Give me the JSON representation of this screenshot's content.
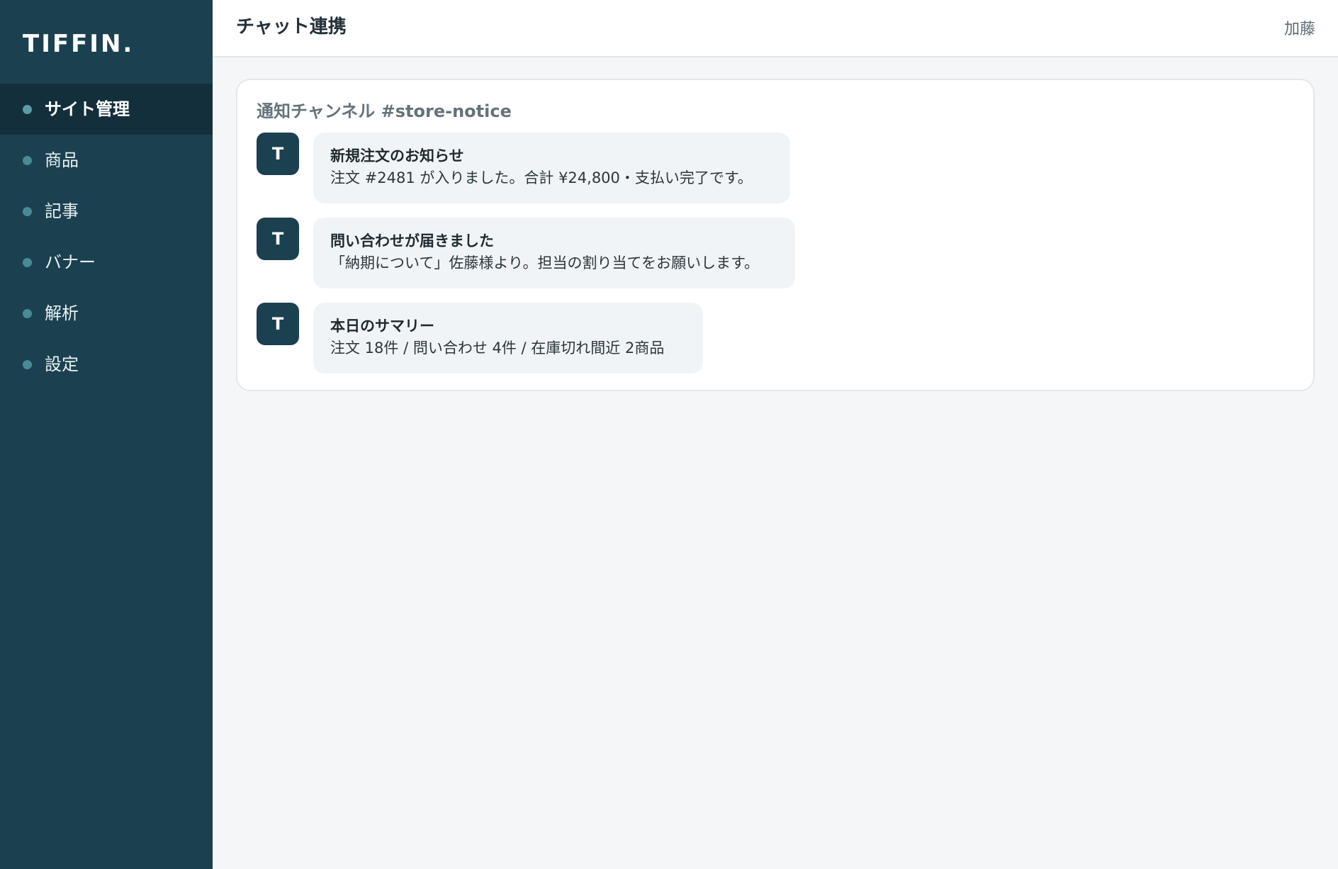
{
  "sidebar": {
    "logo": "TIFFIN.",
    "items": [
      {
        "label": "サイト管理",
        "active": true
      },
      {
        "label": "商品",
        "active": false
      },
      {
        "label": "記事",
        "active": false
      },
      {
        "label": "バナー",
        "active": false
      },
      {
        "label": "解析",
        "active": false
      },
      {
        "label": "設定",
        "active": false
      }
    ]
  },
  "header": {
    "title": "チャット連携",
    "user": "加藤"
  },
  "card": {
    "channel_title": "通知チャンネル #store-notice",
    "messages": [
      {
        "avatar": "T",
        "title": "新規注文のお知らせ",
        "body": "注文 #2481 が入りました。合計 ¥24,800・支払い完了です。"
      },
      {
        "avatar": "T",
        "title": "問い合わせが届きました",
        "body": "「納期について」佐藤様より。担当の割り当てをお願いします。"
      },
      {
        "avatar": "T",
        "title": "本日のサマリー",
        "body": "注文 18件 / 問い合わせ 4件 / 在庫切れ間近 2商品"
      }
    ]
  },
  "colors": {
    "sidebar_bg": "#1b4150",
    "sidebar_active_bg": "#132f3b",
    "nav_dot": "#4a8a96",
    "page_bg": "#f4f6f8",
    "bubble_bg": "#f1f4f6",
    "avatar_bg": "#1b4150"
  }
}
